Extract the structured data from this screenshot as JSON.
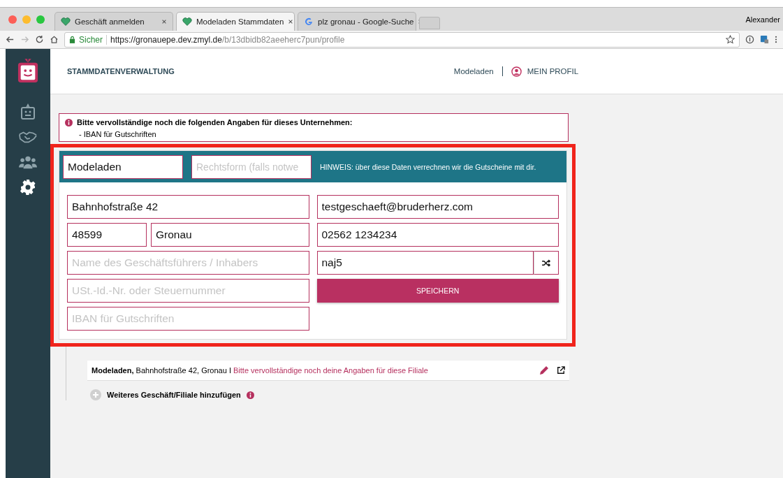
{
  "browser": {
    "tabs": [
      {
        "title": "Geschäft anmelden",
        "kind": "heart",
        "selected": false
      },
      {
        "title": "Modeladen Stammdaten",
        "kind": "heart",
        "selected": true
      },
      {
        "title": "plz gronau - Google-Suche",
        "kind": "google",
        "selected": false
      }
    ],
    "profile_name": "Alexander",
    "secure_label": "Sicher",
    "url_host": "https://gronauepe.dev.zmyl.de",
    "url_path": "/b/13dbidb82aeeherc7pun/profile"
  },
  "sidebar": {
    "items": [
      {
        "kind": "robot",
        "selected": false
      },
      {
        "kind": "handshake",
        "selected": false
      },
      {
        "kind": "people",
        "selected": false
      },
      {
        "kind": "gear",
        "selected": true
      }
    ]
  },
  "header": {
    "title": "STAMMDATENVERWALTUNG",
    "nav_link": "Modeladen",
    "profile_link": "MEIN PROFIL"
  },
  "alert": {
    "title": "Bitte vervollständige noch die folgenden Angaben für dieses Unternehmen:",
    "items": [
      "- IBAN für Gutschriften"
    ]
  },
  "company": {
    "name": {
      "value": "Modeladen"
    },
    "legal_form": {
      "placeholder": "Rechtsform (falls notwe"
    },
    "hint": "HINWEIS: über diese Daten verrechnen wir die Gutscheine mit dir."
  },
  "form": {
    "street": {
      "value": "Bahnhofstraße 42"
    },
    "postal_code": {
      "value": "48599"
    },
    "city": {
      "value": "Gronau"
    },
    "manager": {
      "placeholder": "Name des Geschäftsführers / Inhabers"
    },
    "tax_id": {
      "placeholder": "USt.-Id.-Nr. oder Steuernummer"
    },
    "iban": {
      "placeholder": "IBAN für Gutschriften"
    },
    "email": {
      "value": "testgeschaeft@bruderherz.com"
    },
    "phone": {
      "value": "02562 1234234"
    },
    "code": {
      "value": "naj5"
    },
    "save_button": "SPEICHERN"
  },
  "branch": {
    "name": "Modeladen,",
    "address": "Bahnhofstraße 42, Gronau I",
    "warning": "Bitte vervollständige noch deine Angaben für diese Filiale"
  },
  "add_branch": "Weiteres Geschäft/Filiale hinzufügen"
}
